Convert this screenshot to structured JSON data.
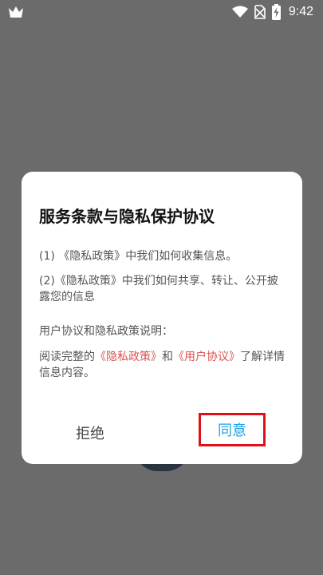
{
  "status_bar": {
    "time": "9:42",
    "icons": [
      "crown-icon",
      "wifi-icon",
      "no-sim-icon",
      "battery-charging-icon"
    ]
  },
  "dialog": {
    "title": "服务条款与隐私保护协议",
    "item1": "(1) 《隐私政策》中我们如何收集信息。",
    "item2": "(2)《隐私政策》中我们如何共享、转让、公开披露您的信息",
    "note": "用户协议和隐私政策说明：",
    "read_prefix": "阅读完整的",
    "privacy_link": "《隐私政策》",
    "and": "和",
    "user_link": "《用户协议》",
    "read_suffix": "了解详情信息内容。",
    "reject_label": "拒绝",
    "agree_label": "同意"
  },
  "colors": {
    "overlay": "#6b6b6b",
    "link": "#d9534f",
    "agree_text": "#1ea0e8",
    "highlight_border": "#e0101a"
  }
}
